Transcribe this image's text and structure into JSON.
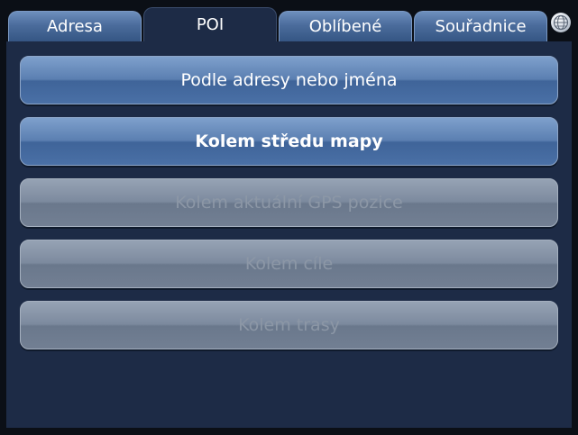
{
  "tabs": [
    {
      "label": "Adresa",
      "active": false
    },
    {
      "label": "POI",
      "active": true
    },
    {
      "label": "Oblíbené",
      "active": false
    },
    {
      "label": "Souřadnice",
      "active": false
    }
  ],
  "buttons": [
    {
      "label": "Podle adresy nebo jména",
      "enabled": true
    },
    {
      "label": "Kolem středu mapy",
      "enabled": true
    },
    {
      "label": "Kolem aktuální GPS pozice",
      "enabled": false
    },
    {
      "label": "Kolem cíle",
      "enabled": false
    },
    {
      "label": "Kolem trasy",
      "enabled": false
    }
  ],
  "icons": {
    "globe": "globe-icon"
  },
  "colors": {
    "panel": "#1d2b46",
    "button_enabled": "#4a70a6",
    "button_disabled": "#7c8a9e"
  }
}
